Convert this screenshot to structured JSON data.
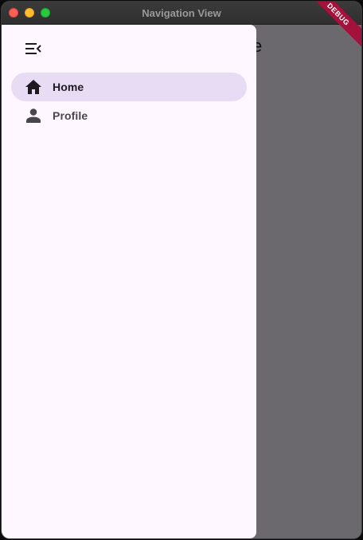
{
  "window": {
    "title": "Navigation View"
  },
  "page": {
    "title_fragment": "e"
  },
  "drawer": {
    "menu_icon": "menu-open-icon",
    "items": [
      {
        "label": "Home",
        "icon": "home-icon",
        "selected": true
      },
      {
        "label": "Profile",
        "icon": "person-icon",
        "selected": false
      }
    ]
  },
  "debug_banner": {
    "label": "DEBUG"
  },
  "colors": {
    "drawer_bg": "#fef7ff",
    "selected_indicator": "#e8dcf4",
    "scrim": "#6b696d",
    "debug_banner": "#a4113a"
  }
}
